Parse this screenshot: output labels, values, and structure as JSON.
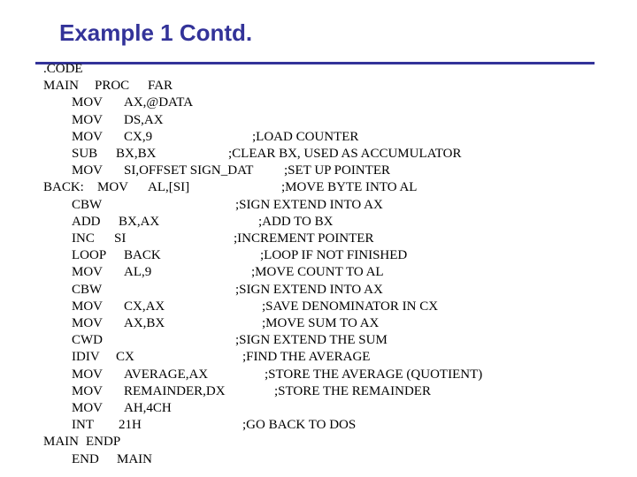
{
  "slide": {
    "title": "Example 1 Contd.",
    "accent_color": "#333399"
  },
  "code": {
    "lines": [
      {
        "label": ".CODE",
        "op": "",
        "args": "",
        "comment": ""
      },
      {
        "label": "MAIN",
        "op": "PROC",
        "args": "FAR",
        "comment": ""
      },
      {
        "label": "",
        "op": "MOV",
        "args": "AX,@DATA",
        "comment": ""
      },
      {
        "label": "",
        "op": "MOV",
        "args": "DS,AX",
        "comment": ""
      },
      {
        "label": "",
        "op": "MOV",
        "args": "CX,9",
        "comment": ";LOAD COUNTER"
      },
      {
        "label": "",
        "op": "SUB",
        "args": "BX,BX",
        "comment": ";CLEAR BX, USED AS ACCUMULATOR"
      },
      {
        "label": "",
        "op": "MOV",
        "args": "SI,OFFSET SIGN_DAT",
        "comment": ";SET UP POINTER"
      },
      {
        "label": "BACK:",
        "op": "MOV",
        "args": "AL,[SI]",
        "comment": ";MOVE BYTE INTO AL"
      },
      {
        "label": "",
        "op": "CBW",
        "args": "",
        "comment": ";SIGN EXTEND INTO AX"
      },
      {
        "label": "",
        "op": "ADD",
        "args": "BX,AX",
        "comment": ";ADD TO BX"
      },
      {
        "label": "",
        "op": "INC",
        "args": "SI",
        "comment": ";INCREMENT POINTER"
      },
      {
        "label": "",
        "op": "LOOP",
        "args": "BACK",
        "comment": ";LOOP IF NOT FINISHED"
      },
      {
        "label": "",
        "op": "MOV",
        "args": "AL,9",
        "comment": ";MOVE COUNT TO AL"
      },
      {
        "label": "",
        "op": "CBW",
        "args": "",
        "comment": ";SIGN EXTEND INTO AX"
      },
      {
        "label": "",
        "op": "MOV",
        "args": "CX,AX",
        "comment": ";SAVE DENOMINATOR IN CX"
      },
      {
        "label": "",
        "op": "MOV",
        "args": "AX,BX",
        "comment": ";MOVE SUM TO AX"
      },
      {
        "label": "",
        "op": "CWD",
        "args": "",
        "comment": ";SIGN EXTEND THE SUM"
      },
      {
        "label": "",
        "op": "IDIV",
        "args": "CX",
        "comment": ";FIND THE AVERAGE"
      },
      {
        "label": "",
        "op": "MOV",
        "args": "AVERAGE,AX",
        "comment": ";STORE THE AVERAGE (QUOTIENT)"
      },
      {
        "label": "",
        "op": "MOV",
        "args": "REMAINDER,DX",
        "comment": ";STORE THE REMAINDER"
      },
      {
        "label": "",
        "op": "MOV",
        "args": "AH,4CH",
        "comment": ""
      },
      {
        "label": "",
        "op": "INT",
        "args": "21H",
        "comment": ";GO BACK TO DOS"
      },
      {
        "label": "MAIN",
        "op": "ENDP",
        "args": "",
        "comment": ""
      },
      {
        "label": "",
        "op": "END",
        "args": "MAIN",
        "comment": ""
      }
    ]
  }
}
